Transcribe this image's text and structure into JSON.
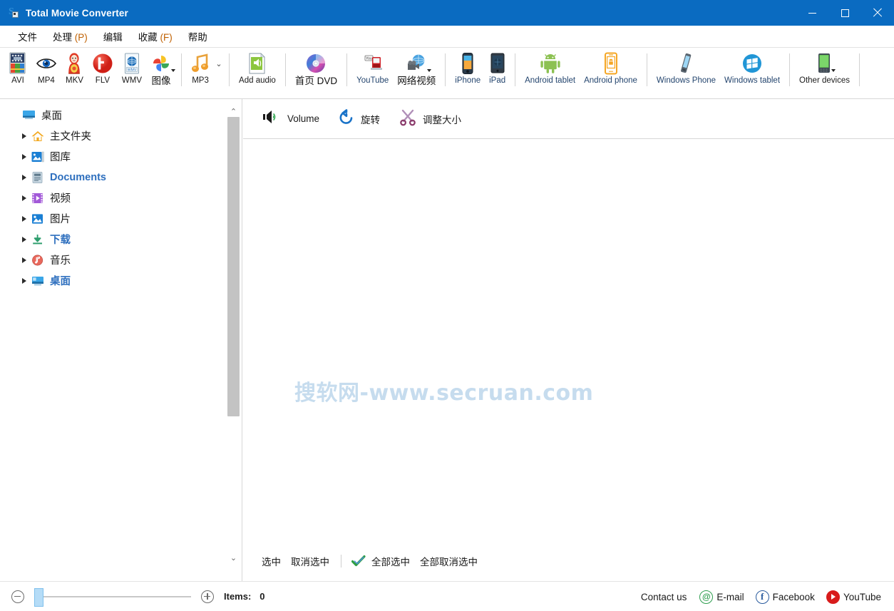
{
  "window": {
    "title": "Total Movie Converter",
    "icon": "app-logo-icon",
    "minimize": "–",
    "maximize": "□",
    "close": "✕"
  },
  "menubar": [
    {
      "label": "文件",
      "accel": ""
    },
    {
      "label": "处理",
      "accel": "(P)"
    },
    {
      "label": "编辑",
      "accel": ""
    },
    {
      "label": "收藏",
      "accel": "(F)"
    },
    {
      "label": "帮助",
      "accel": ""
    }
  ],
  "toolbar": {
    "groups": [
      {
        "buttons": [
          {
            "label": "AVI",
            "icon": "avi-file-icon",
            "caret": false
          },
          {
            "label": "MP4",
            "icon": "eye-icon",
            "caret": false
          },
          {
            "label": "MKV",
            "icon": "matryoshka-icon",
            "caret": false
          },
          {
            "label": "FLV",
            "icon": "flash-icon",
            "caret": false
          },
          {
            "label": "WMV",
            "icon": "wmv-file-icon",
            "caret": false
          },
          {
            "label": "图像",
            "icon": "pinwheel-photos-icon",
            "caret": true
          }
        ]
      },
      {
        "buttons": [
          {
            "label": "MP3",
            "icon": "music-note-icon",
            "caret": false,
            "chevron": true
          }
        ]
      },
      {
        "buttons": [
          {
            "label": "Add audio",
            "icon": "add-audio-icon",
            "caret": false
          }
        ]
      },
      {
        "buttons": [
          {
            "label": "首页 DVD",
            "icon": "dvd-disc-icon",
            "caret": false
          }
        ]
      },
      {
        "buttons": [
          {
            "label": "YouTube",
            "icon": "youtube-icon",
            "caret": false
          },
          {
            "label": "网络视频",
            "icon": "web-video-icon",
            "caret": true
          }
        ]
      },
      {
        "buttons": [
          {
            "label": "iPhone",
            "icon": "iphone-icon",
            "caret": false
          },
          {
            "label": "iPad",
            "icon": "ipad-icon",
            "caret": false
          }
        ]
      },
      {
        "buttons": [
          {
            "label": "Android tablet",
            "icon": "android-robot-icon",
            "caret": false
          },
          {
            "label": "Android phone",
            "icon": "android-phone-icon",
            "caret": false
          }
        ]
      },
      {
        "buttons": [
          {
            "label": "Windows Phone",
            "icon": "windows-phone-icon",
            "caret": false
          },
          {
            "label": "Windows tablet",
            "icon": "windows-logo-icon",
            "caret": false
          }
        ]
      },
      {
        "buttons": [
          {
            "label": "Other devices",
            "icon": "other-device-icon",
            "caret": true
          }
        ]
      }
    ]
  },
  "tree": {
    "root": {
      "label": "桌面",
      "icon": "desktop-icon",
      "highlight": false
    },
    "items": [
      {
        "label": "主文件夹",
        "icon": "home-folder-icon",
        "highlight": false
      },
      {
        "label": "图库",
        "icon": "gallery-icon",
        "highlight": false
      },
      {
        "label": "Documents",
        "icon": "documents-icon",
        "highlight": true
      },
      {
        "label": "视频",
        "icon": "videos-icon",
        "highlight": false
      },
      {
        "label": "图片",
        "icon": "pictures-icon",
        "highlight": false
      },
      {
        "label": "下载",
        "icon": "downloads-icon",
        "highlight": true
      },
      {
        "label": "音乐",
        "icon": "music-icon",
        "highlight": false
      },
      {
        "label": "桌面",
        "icon": "desktop-folder-icon",
        "highlight": true
      }
    ],
    "scroll_up": "⌃",
    "scroll_down": "⌄"
  },
  "subtoolbar": {
    "buttons": [
      {
        "label": "Volume",
        "icon": "speaker-volume-icon"
      },
      {
        "label": "旋转",
        "icon": "rotate-icon"
      },
      {
        "label": "调整大小",
        "icon": "scissors-resize-icon"
      }
    ]
  },
  "filelist": {
    "watermark": "搜软网-www.secruan.com",
    "watermark_color": "#c6dcee"
  },
  "selection_bar": {
    "select": "选中",
    "deselect": "取消选中",
    "check_icon": "green-check-icon",
    "select_all": "全部选中",
    "deselect_all": "全部取消选中"
  },
  "statusbar": {
    "zoom_out": "zoom-out-icon",
    "zoom_in": "zoom-in-icon",
    "slider_value": 0,
    "items_label": "Items:",
    "items_count": "0",
    "contact_label": "Contact us",
    "social": [
      {
        "label": "E-mail",
        "icon": "email-at-icon",
        "glyph": "@"
      },
      {
        "label": "Facebook",
        "icon": "facebook-icon",
        "glyph": "f"
      },
      {
        "label": "YouTube",
        "icon": "youtube-play-icon",
        "glyph": ""
      }
    ]
  },
  "colors": {
    "titlebar": "#0a6bc1",
    "accent_blue": "#2e6fbe",
    "watermark": "#c6dcee"
  }
}
